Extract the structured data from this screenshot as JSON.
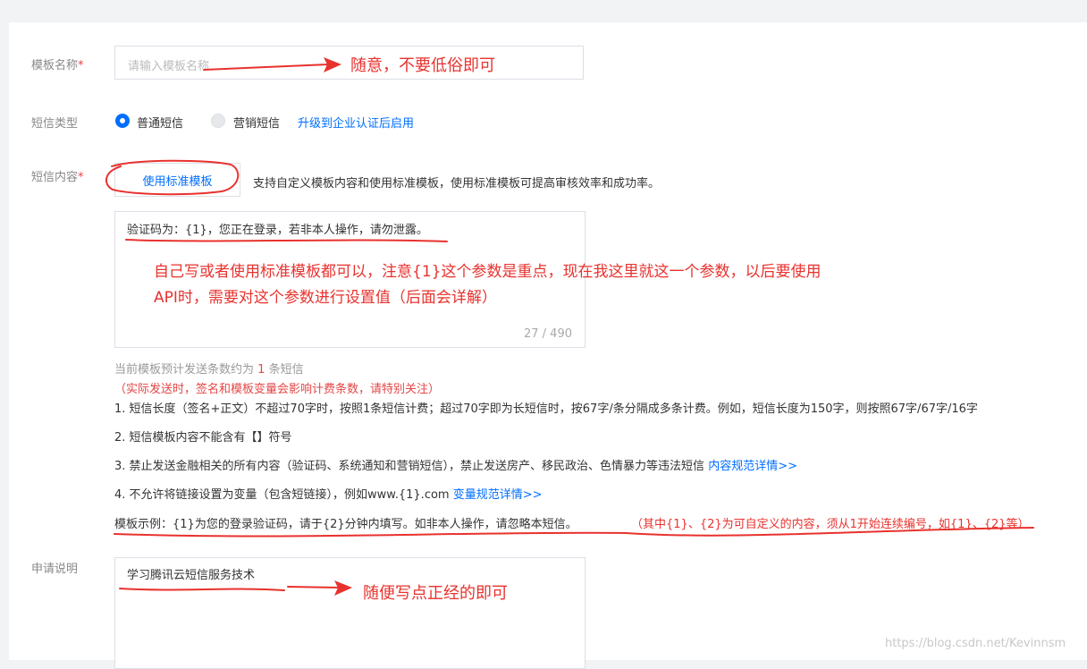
{
  "form": {
    "template_name": {
      "label": "模板名称",
      "required_mark": "*",
      "placeholder": "请输入模板名称",
      "annotation": "随意，不要低俗即可"
    },
    "sms_type": {
      "label": "短信类型",
      "option_normal": "普通短信",
      "option_marketing": "营销短信",
      "upgrade_link": "升级到企业认证后启用",
      "selected": "普通短信"
    },
    "sms_content": {
      "label": "短信内容",
      "required_mark": "*",
      "std_template_button": "使用标准模板",
      "hint": "支持自定义模板内容和使用标准模板，使用标准模板可提高审核效率和成功率。",
      "value": "验证码为：{1}，您正在登录，若非本人操作，请勿泄露。",
      "annotation_line1": "自己写或者使用标准模板都可以，注意{1}这个参数是重点，现在我这里就这一个参数，以后要使用",
      "annotation_line2": "API时，需要对这个参数进行设置值（后面会详解）",
      "char_count": "27 / 490",
      "estimate_prefix": "当前模板预计发送条数约为",
      "estimate_count": "1",
      "estimate_suffix": "条短信",
      "billing_warning": "（实际发送时，签名和模板变量会影响计费条数，请特别关注）",
      "rules": [
        {
          "text": "1. 短信长度（签名+正文）不超过70字时，按照1条短信计费；超过70字即为长短信时，按67字/条分隔成多条计费。例如，短信长度为150字，则按照67字/67字/16字",
          "link": ""
        },
        {
          "text": "2. 短信模板内容不能含有【】符号",
          "link": ""
        },
        {
          "text": "3. 禁止发送金融相关的所有内容（验证码、系统通知和营销短信），禁止发送房产、移民政治、色情暴力等违法短信",
          "link": "内容规范详情>>"
        },
        {
          "text": "4. 不允许将链接设置为变量（包含短链接），例如www.{1}.com",
          "link": "变量规范详情>>"
        }
      ],
      "example": "模板示例：{1}为您的登录验证码，请于{2}分钟内填写。如非本人操作，请忽略本短信。",
      "example_note": "（其中{1}、{2}为可自定义的内容，须从1开始连续编号，如{1}、{2}等）"
    },
    "application_note": {
      "label": "申请说明",
      "value": "学习腾讯云短信服务技术",
      "annotation": "随便写点正经的即可"
    }
  },
  "watermark": "https://blog.csdn.net/Kevinnsm",
  "colors": {
    "accent": "#006eff",
    "annotation_red": "#e8322e",
    "required_red": "#e54545"
  }
}
